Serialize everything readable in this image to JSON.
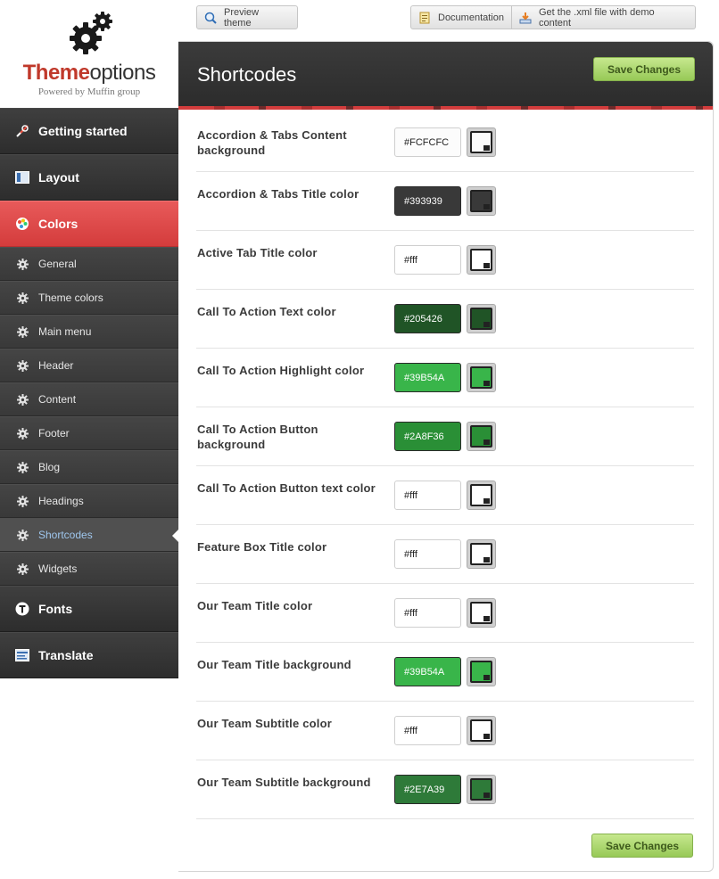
{
  "logo": {
    "brand_bold": "Theme",
    "brand_rest": "options",
    "powered": "Powered by Muffin group"
  },
  "toolbar": {
    "preview_label": "Preview theme",
    "docs_label": "Documentation",
    "xml_label": "Get the .xml file with demo content"
  },
  "sidebar": {
    "main_items": [
      {
        "label": "Getting started",
        "icon": "tools-icon"
      },
      {
        "label": "Layout",
        "icon": "layout-icon"
      },
      {
        "label": "Colors",
        "icon": "palette-icon"
      },
      {
        "label": "Fonts",
        "icon": "font-icon"
      },
      {
        "label": "Translate",
        "icon": "translate-icon"
      }
    ],
    "sub_items": [
      {
        "label": "General"
      },
      {
        "label": "Theme colors"
      },
      {
        "label": "Main menu"
      },
      {
        "label": "Header"
      },
      {
        "label": "Content"
      },
      {
        "label": "Footer"
      },
      {
        "label": "Blog"
      },
      {
        "label": "Headings"
      },
      {
        "label": "Shortcodes"
      },
      {
        "label": "Widgets"
      }
    ]
  },
  "panel": {
    "title": "Shortcodes",
    "save_label": "Save Changes"
  },
  "options": [
    {
      "label": "Accordion & Tabs Content background",
      "value": "#FCFCFC",
      "color": "#FCFCFC"
    },
    {
      "label": "Accordion & Tabs Title color",
      "value": "#393939",
      "color": "#393939"
    },
    {
      "label": "Active Tab Title color",
      "value": "#fff",
      "color": "#ffffff"
    },
    {
      "label": "Call To Action Text color",
      "value": "#205426",
      "color": "#205426"
    },
    {
      "label": "Call To Action Highlight color",
      "value": "#39B54A",
      "color": "#39B54A"
    },
    {
      "label": "Call To Action Button background",
      "value": "#2A8F36",
      "color": "#2A8F36"
    },
    {
      "label": "Call To Action Button text color",
      "value": "#fff",
      "color": "#ffffff"
    },
    {
      "label": "Feature Box Title color",
      "value": "#fff",
      "color": "#ffffff"
    },
    {
      "label": "Our Team Title color",
      "value": "#fff",
      "color": "#ffffff"
    },
    {
      "label": "Our Team Title background",
      "value": "#39B54A",
      "color": "#39B54A"
    },
    {
      "label": "Our Team Subtitle color",
      "value": "#fff",
      "color": "#ffffff"
    },
    {
      "label": "Our Team Subtitle background",
      "value": "#2E7A39",
      "color": "#2E7A39"
    }
  ]
}
